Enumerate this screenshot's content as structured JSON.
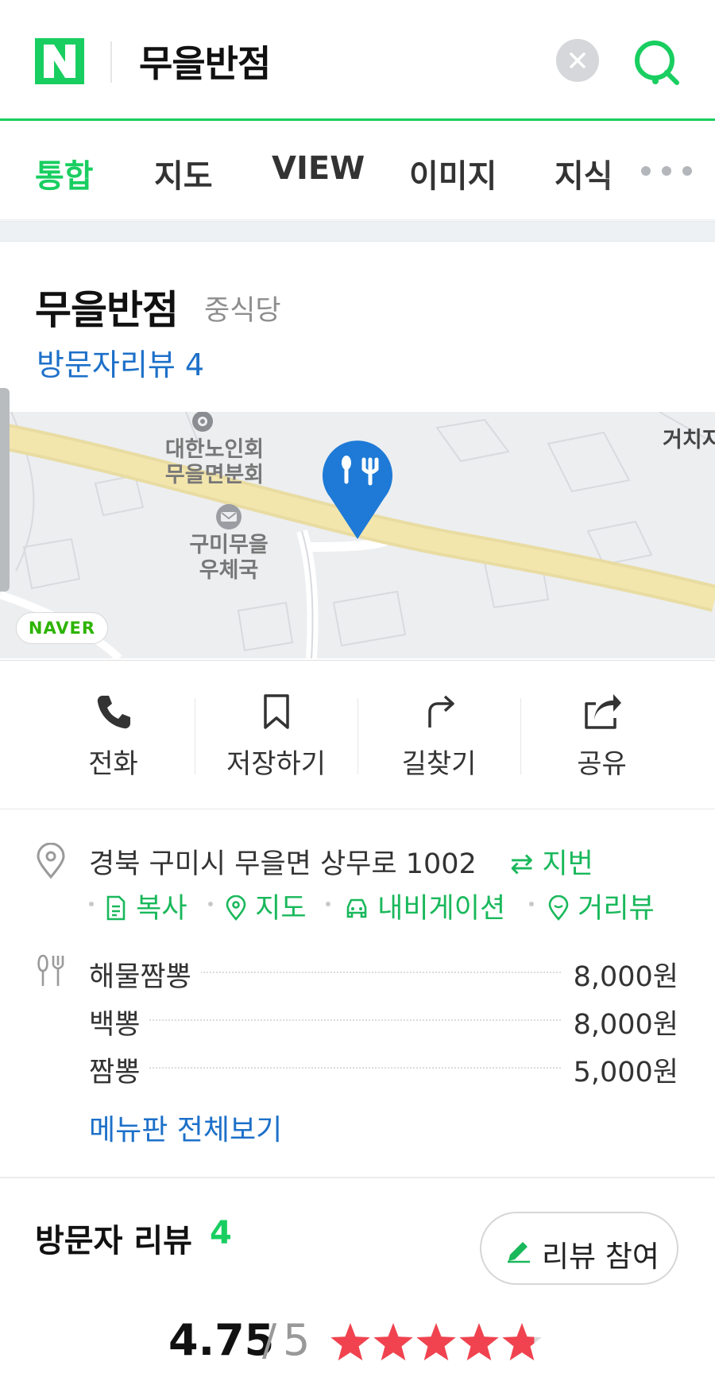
{
  "search": {
    "logo_letter": "N",
    "query": "무을반점"
  },
  "tabs": [
    {
      "label": "통합",
      "active": true
    },
    {
      "label": "지도",
      "active": false
    },
    {
      "label": "VIEW",
      "active": false
    },
    {
      "label": "이미지",
      "active": false
    },
    {
      "label": "지식",
      "active": false
    }
  ],
  "place": {
    "name": "무을반점",
    "category": "중식당",
    "review_link": "방문자리뷰 4"
  },
  "map": {
    "labels": {
      "senior_center": "대한노인회\n무을면분회",
      "post_office": "구미무을\n우체국",
      "right_edge": "거치지"
    },
    "badge": "NAVER"
  },
  "actions": [
    {
      "label": "전화",
      "icon": "phone-icon"
    },
    {
      "label": "저장하기",
      "icon": "bookmark-icon"
    },
    {
      "label": "길찾기",
      "icon": "directions-icon"
    },
    {
      "label": "공유",
      "icon": "share-icon"
    }
  ],
  "info": {
    "address": "경북 구미시 무을면 상무로 1002",
    "jibun_label": "⇄ 지번",
    "address_links": [
      {
        "label": "복사",
        "icon": "copy-icon"
      },
      {
        "label": "지도",
        "icon": "map-pin-icon"
      },
      {
        "label": "내비게이션",
        "icon": "car-icon"
      },
      {
        "label": "거리뷰",
        "icon": "streetview-icon"
      }
    ],
    "menu": [
      {
        "name": "해물짬뽕",
        "price": "8,000원"
      },
      {
        "name": "백뽕",
        "price": "8,000원"
      },
      {
        "name": "짬뽕",
        "price": "5,000원"
      }
    ],
    "menu_all_link": "메뉴판 전체보기"
  },
  "reviews": {
    "title": "방문자 리뷰",
    "count": "4",
    "button_label": "리뷰 참여",
    "rating": "4.75",
    "separator": "/",
    "max": "5",
    "rating_fraction": 0.95
  },
  "colors": {
    "naver_green": "#19ce60",
    "link_blue": "#1d70c9",
    "pin_blue": "#1e7ad6",
    "star_red": "#f0434f"
  }
}
